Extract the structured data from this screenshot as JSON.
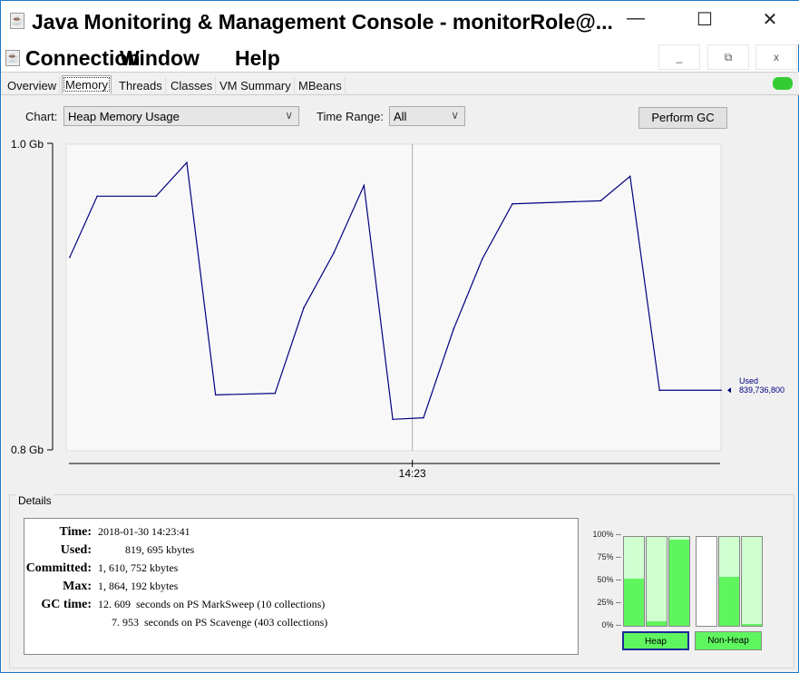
{
  "window": {
    "title": "Java Monitoring & Management Console - monitorRole@...",
    "minimize": "—",
    "maximize": "☐",
    "close": "✕"
  },
  "menubar": {
    "items": [
      "Connection",
      "Window",
      "Help"
    ],
    "inner_min": "_",
    "inner_restore": "⧉",
    "inner_close": "x"
  },
  "tabs": [
    "Overview",
    "Memory",
    "Threads",
    "Classes",
    "VM Summary",
    "MBeans"
  ],
  "active_tab": "Memory",
  "controls": {
    "chart_label": "Chart:",
    "chart_value": "Heap Memory Usage",
    "time_range_label": "Time Range:",
    "time_range_value": "All",
    "perform_gc": "Perform GC"
  },
  "chart_data": {
    "type": "line",
    "ylabel": "",
    "xlabel": "",
    "ylim": [
      0.8,
      1.0
    ],
    "y_tick_labels": [
      "1.0 Gb",
      "0.8 Gb"
    ],
    "x_tick_labels": [
      {
        "label": "14:23",
        "t": 52.8
      }
    ],
    "xlim": [
      0,
      100
    ],
    "series": [
      {
        "name": "Used",
        "color": "#000080",
        "t": [
          0.4,
          4.6,
          13.6,
          18.3,
          22.7,
          31.8,
          36.2,
          40.8,
          45.4,
          49.8,
          54.5,
          59.1,
          63.5,
          68.1,
          81.6,
          86.1,
          90.6,
          100
        ],
        "values": [
          0.926,
          0.966,
          0.966,
          0.988,
          0.836,
          0.837,
          0.893,
          0.929,
          0.973,
          0.82,
          0.821,
          0.879,
          0.925,
          0.961,
          0.963,
          0.979,
          0.839,
          0.839
        ]
      }
    ],
    "legend": {
      "label": "Used",
      "value": "839,736,800"
    }
  },
  "details": {
    "title": "Details",
    "rows": [
      {
        "key": "Time:",
        "value": "2018-01-30 14:23:41"
      },
      {
        "key": "Used:",
        "value": "          819, 695 kbytes"
      },
      {
        "key": "Committed:",
        "value": "1, 610, 752 kbytes"
      },
      {
        "key": "Max:",
        "value": "1, 864, 192 kbytes"
      },
      {
        "key": "GC time:",
        "value": "12. 609  seconds on PS MarkSweep (10 collections)"
      },
      {
        "key": "",
        "value": "     7. 953  seconds on PS Scavenge (403 collections)"
      }
    ]
  },
  "pools": {
    "pct_labels": [
      "100% --",
      "75% --",
      "50% --",
      "25% --",
      "0% --"
    ],
    "heap_label": "Heap",
    "nonheap_label": "Non-Heap",
    "heap_used_pct": [
      53,
      5,
      97
    ],
    "nonheap_used_pct": [
      0,
      55,
      2
    ],
    "color": "#5ff55f"
  }
}
